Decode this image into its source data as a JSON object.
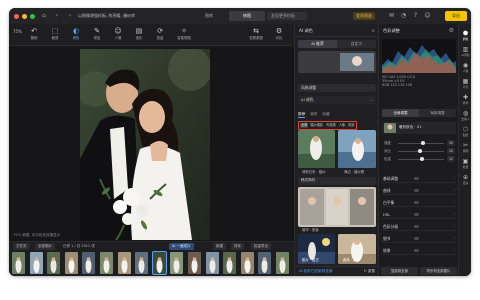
{
  "window": {
    "breadcrumb": "以图像增强样板, 陈亮暖, 婚纱库",
    "tabs": [
      "图库",
      "修图",
      "导出"
    ],
    "active_tab": "修图",
    "search_placeholder": "发现更多样板",
    "vip_badge": "会员权益",
    "export_label": "导出"
  },
  "toolbar": {
    "ratio_label": "75%",
    "tools": [
      {
        "icon": "↶",
        "label": "撤销"
      },
      {
        "icon": "⬚",
        "label": "裁剪"
      },
      {
        "icon": "◐",
        "label": "调色"
      },
      {
        "icon": "✎",
        "label": "修复"
      },
      {
        "icon": "☺",
        "label": "人像"
      },
      {
        "icon": "▤",
        "label": "液化"
      },
      {
        "icon": "⟳",
        "label": "批量"
      },
      {
        "icon": "✧",
        "label": "智能修图"
      }
    ],
    "active_tool": "调色",
    "right_tools": [
      {
        "icon": "⇆",
        "label": "查看原图"
      },
      {
        "icon": "⚙",
        "label": "对比"
      }
    ]
  },
  "canvas": {
    "hint": "75% 原图, 本次优化效果显示"
  },
  "filmstrip": {
    "bar_items": [
      "文件夹",
      "全部图片",
      "已修 1 / 共 2012 张",
      "AI 一键成片",
      "新建",
      "排序",
      "批量导出"
    ],
    "thumb_count": 16,
    "selected_index": 8
  },
  "ai_panel": {
    "title": "AI 调色",
    "close_icon": "✕",
    "segments": [
      "AI 推荐",
      "自定义"
    ],
    "active_segment": "AI 推荐",
    "sub_rows": [
      {
        "label": "风格调整"
      },
      {
        "label": "AI 调色"
      }
    ],
    "tabs": [
      "推荐",
      "我的",
      "收藏"
    ],
    "active_tab": "推荐",
    "chips": [
      "全部",
      "婚纱摄影",
      "写真照",
      "人像",
      "风景"
    ],
    "active_chip": "全部",
    "cards": [
      {
        "label": "清新日系 · 婚纱"
      },
      {
        "label": "海边 · 婚纱照"
      },
      {
        "label": "韩式简约"
      },
      {
        "label": "城市 · 夜景"
      },
      {
        "label": "胶片 · 复古"
      },
      {
        "label": "森系 · 婚纱"
      }
    ],
    "footer_link": "AI 色彩已应用到全部",
    "footer_action": "↻ 重置"
  },
  "color_panel": {
    "title": "色彩调整",
    "gear_icon": "⚙",
    "info_lines": [
      "ISO 100  1/250  f/2.8",
      "35mm  ±0 EV",
      "RGB  123  116  108"
    ],
    "tabs": [
      "全局调整",
      "局部调整"
    ],
    "active_tab": "全局调整",
    "preset_name": "暖系肤色 · 01",
    "sliders": [
      {
        "label": "强度",
        "value": "50",
        "pos": 0.55
      },
      {
        "label": "对比",
        "value": "20",
        "pos": 0.48
      },
      {
        "label": "色温",
        "value": "12",
        "pos": 0.52
      }
    ],
    "sections": [
      "基础调整",
      "曲线",
      "白平衡",
      "HSL",
      "色彩分级",
      "细节",
      "效果"
    ],
    "footer_buttons": [
      "复制到全部",
      "同步到全部图片"
    ]
  },
  "rail": {
    "items": [
      {
        "icon": "⬢",
        "label": "调色"
      },
      {
        "icon": "▥",
        "label": "AI调色"
      },
      {
        "icon": "◉",
        "label": "人像"
      },
      {
        "icon": "▦",
        "label": "背景"
      },
      {
        "icon": "✚",
        "label": "修饰"
      },
      {
        "icon": "◍",
        "label": "去路人"
      },
      {
        "icon": "⬡",
        "label": "贴纸"
      },
      {
        "icon": "✂",
        "label": "抠图"
      },
      {
        "icon": "▣",
        "label": "批量"
      },
      {
        "icon": "⊕",
        "label": "更多"
      }
    ],
    "active_index": 0
  },
  "colors": {
    "accent": "#4fa3ff",
    "export": "#f5c400",
    "highlight_border": "#e0472c",
    "window_bg": "#1b1b1d"
  }
}
